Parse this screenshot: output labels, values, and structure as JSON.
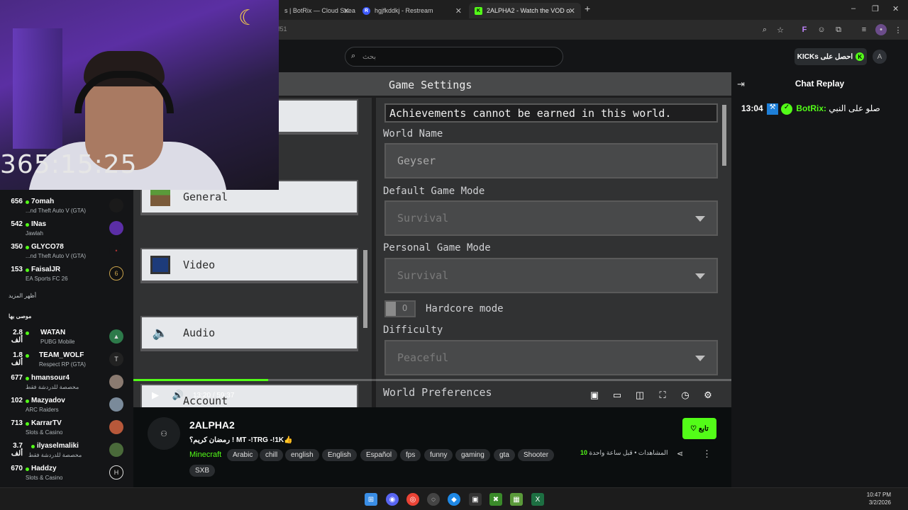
{
  "browser": {
    "tabs": [
      {
        "label": "s | BotRix — Cloud Strea",
        "icon": "botrix-icon",
        "active": false
      },
      {
        "label": "hgjfkddkj - Restream",
        "icon": "restream-icon",
        "active": false
      },
      {
        "label": "2ALPHA2 - Watch the VOD on K",
        "icon": "kick-icon",
        "active": true
      }
    ],
    "new_tab": "+",
    "url": "f51",
    "window_controls": [
      "–",
      "❐",
      "✕"
    ]
  },
  "header": {
    "search_placeholder": "بحث",
    "kicks_button": "KICKs احصل على",
    "profile_initial": "A"
  },
  "webcam": {
    "timer": "365:15:25",
    "moon": "☾"
  },
  "sidebar": {
    "channels": [
      {
        "viewers": "656",
        "name": "7omah",
        "category": "...nd Theft Auto V (GTA)"
      },
      {
        "viewers": "542",
        "name": "INas",
        "category": "Jawlah"
      },
      {
        "viewers": "350",
        "name": "GLYCO78",
        "category": "...nd Theft Auto V (GTA)"
      },
      {
        "viewers": "153",
        "name": "FaisalJR",
        "category": "EA Sports FC 26"
      }
    ],
    "show_more": "أظهر المزيد",
    "recommended_label": "موصى بها",
    "recommended": [
      {
        "viewers": "2.8 ألف",
        "name": "WATAN",
        "category": "PUBG Mobile"
      },
      {
        "viewers": "1.8 ألف",
        "name": "TEAM_WOLF",
        "category": "Respect RP (GTA)"
      },
      {
        "viewers": "677",
        "name": "hmansour4",
        "category": "مخصصة للدردشة فقط"
      },
      {
        "viewers": "102",
        "name": "Mazyadov",
        "category": "ARC Raiders"
      },
      {
        "viewers": "713",
        "name": "KarrarTV",
        "category": "Slots & Casino"
      },
      {
        "viewers": "3.7 ألف",
        "name": "ilyaselmaliki",
        "category": "مخصصة للدردشة فقط"
      },
      {
        "viewers": "670",
        "name": "Haddzy",
        "category": "Slots & Casino"
      }
    ]
  },
  "game": {
    "title": "Game Settings",
    "menu": [
      {
        "label": "General",
        "icon": "grass-block-icon"
      },
      {
        "label": "Video",
        "icon": "monitor-icon"
      },
      {
        "label": "Audio",
        "icon": "speaker-icon"
      },
      {
        "label": "Account",
        "icon": "account-icon"
      }
    ],
    "achievements_notice": "Achievements cannot be earned in this world.",
    "world_name_label": "World Name",
    "world_name_value": "Geyser",
    "default_mode_label": "Default Game Mode",
    "default_mode_value": "Survival",
    "personal_mode_label": "Personal Game Mode",
    "personal_mode_value": "Survival",
    "toggle_off_text": "O",
    "hardcore_label": "Hardcore mode",
    "difficulty_label": "Difficulty",
    "difficulty_value": "Peaceful",
    "world_prefs_label": "World Preferences"
  },
  "player": {
    "current_time": "13:20",
    "separator": "/",
    "duration": "59:37",
    "progress_fraction": 0.225
  },
  "chat": {
    "title": "Chat Replay",
    "message": {
      "time": "13:04",
      "user": "BotRix:",
      "text": "صلو على النبي"
    }
  },
  "stream": {
    "name": "2ALPHA2",
    "title": "رمضان كريم؟ ! MT -!TRG -!1K👍",
    "category": "Minecraft",
    "tags": [
      "Arabic",
      "chill",
      "english",
      "English",
      "Español",
      "fps",
      "funny",
      "gaming",
      "gta",
      "Shooter",
      "SXB"
    ],
    "follow": "♡ تابع",
    "viewers_count": "10",
    "viewers_text": "المشاهدات • قبل ساعة واحدة"
  },
  "taskbar": {
    "time": "10:47 PM",
    "date": "3/2/2026"
  },
  "colors": {
    "kick_green": "#53fc18",
    "minecraft_panel": "#313233",
    "page_bg": "#0b0e0f"
  }
}
